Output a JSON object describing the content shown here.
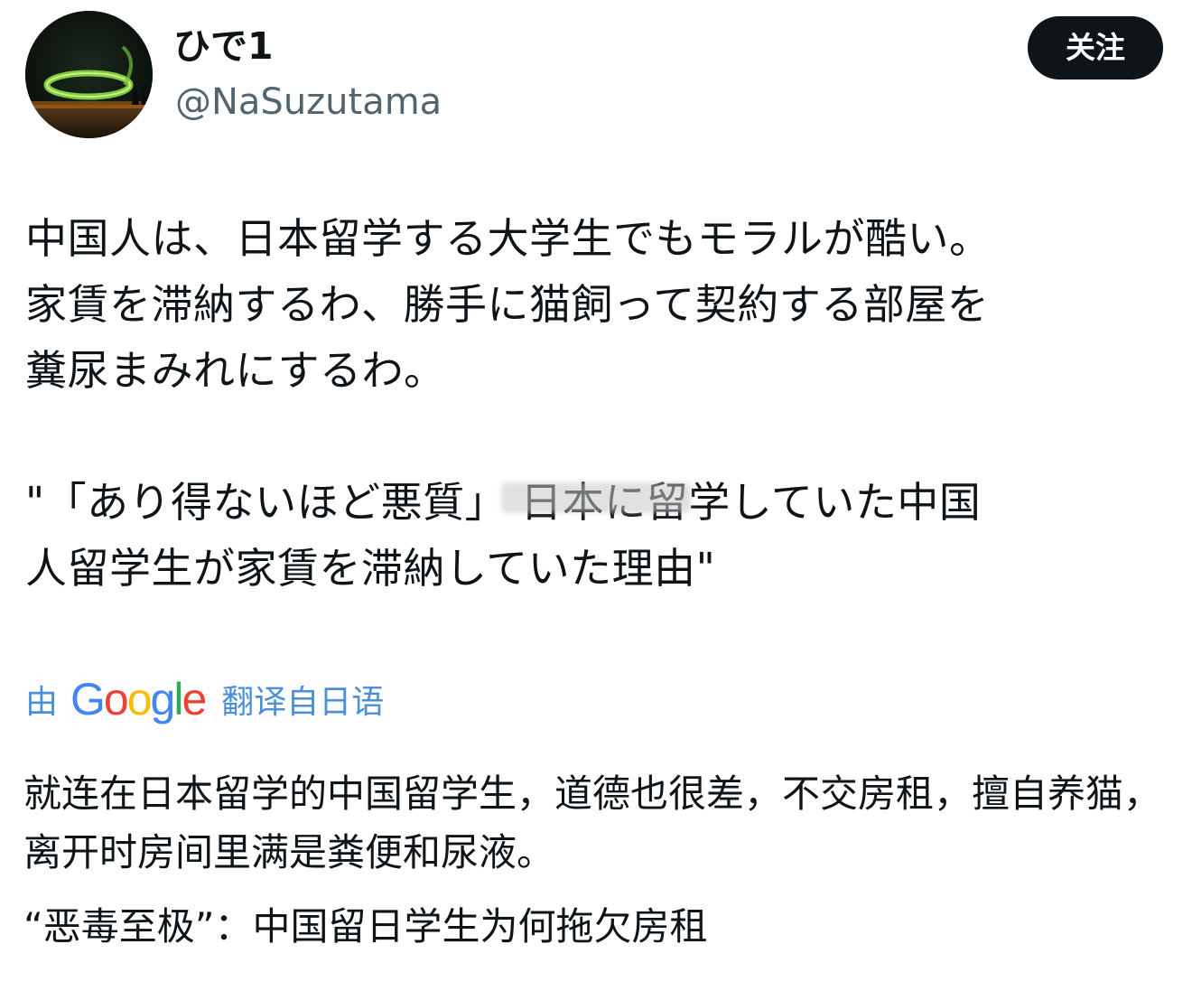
{
  "user": {
    "display_name": "ひで1",
    "handle": "@NaSuzutama",
    "avatar_icon": "aurora-avatar-icon"
  },
  "follow_button": {
    "label": "关注"
  },
  "original_text": {
    "paragraph1": "中国人は、日本留学する大学生でもモラルが酷い。\n家賃を滞納するわ、勝手に猫飼って契約する部屋を\n糞尿まみれにするわ。",
    "paragraph2": "\"「あり得ないほど悪質」 日本に留学していた中国\n人留学生が家賃を滞納していた理由\""
  },
  "translation": {
    "by_label": "由",
    "provider": "Google",
    "from_label": "翻译自日语",
    "colors": {
      "G": "#4285F4",
      "o1": "#EA4335",
      "o2": "#FBBC05",
      "g": "#4285F4",
      "l": "#34A853",
      "e": "#EA4335"
    }
  },
  "translated_text": {
    "paragraph1": "就连在日本留学的中国留学生，道德也很差，不交房租，擅自养猫，离开时房间里满是粪便和尿液。",
    "paragraph2": "“恶毒至极”：中国留日学生为何拖欠房租"
  }
}
